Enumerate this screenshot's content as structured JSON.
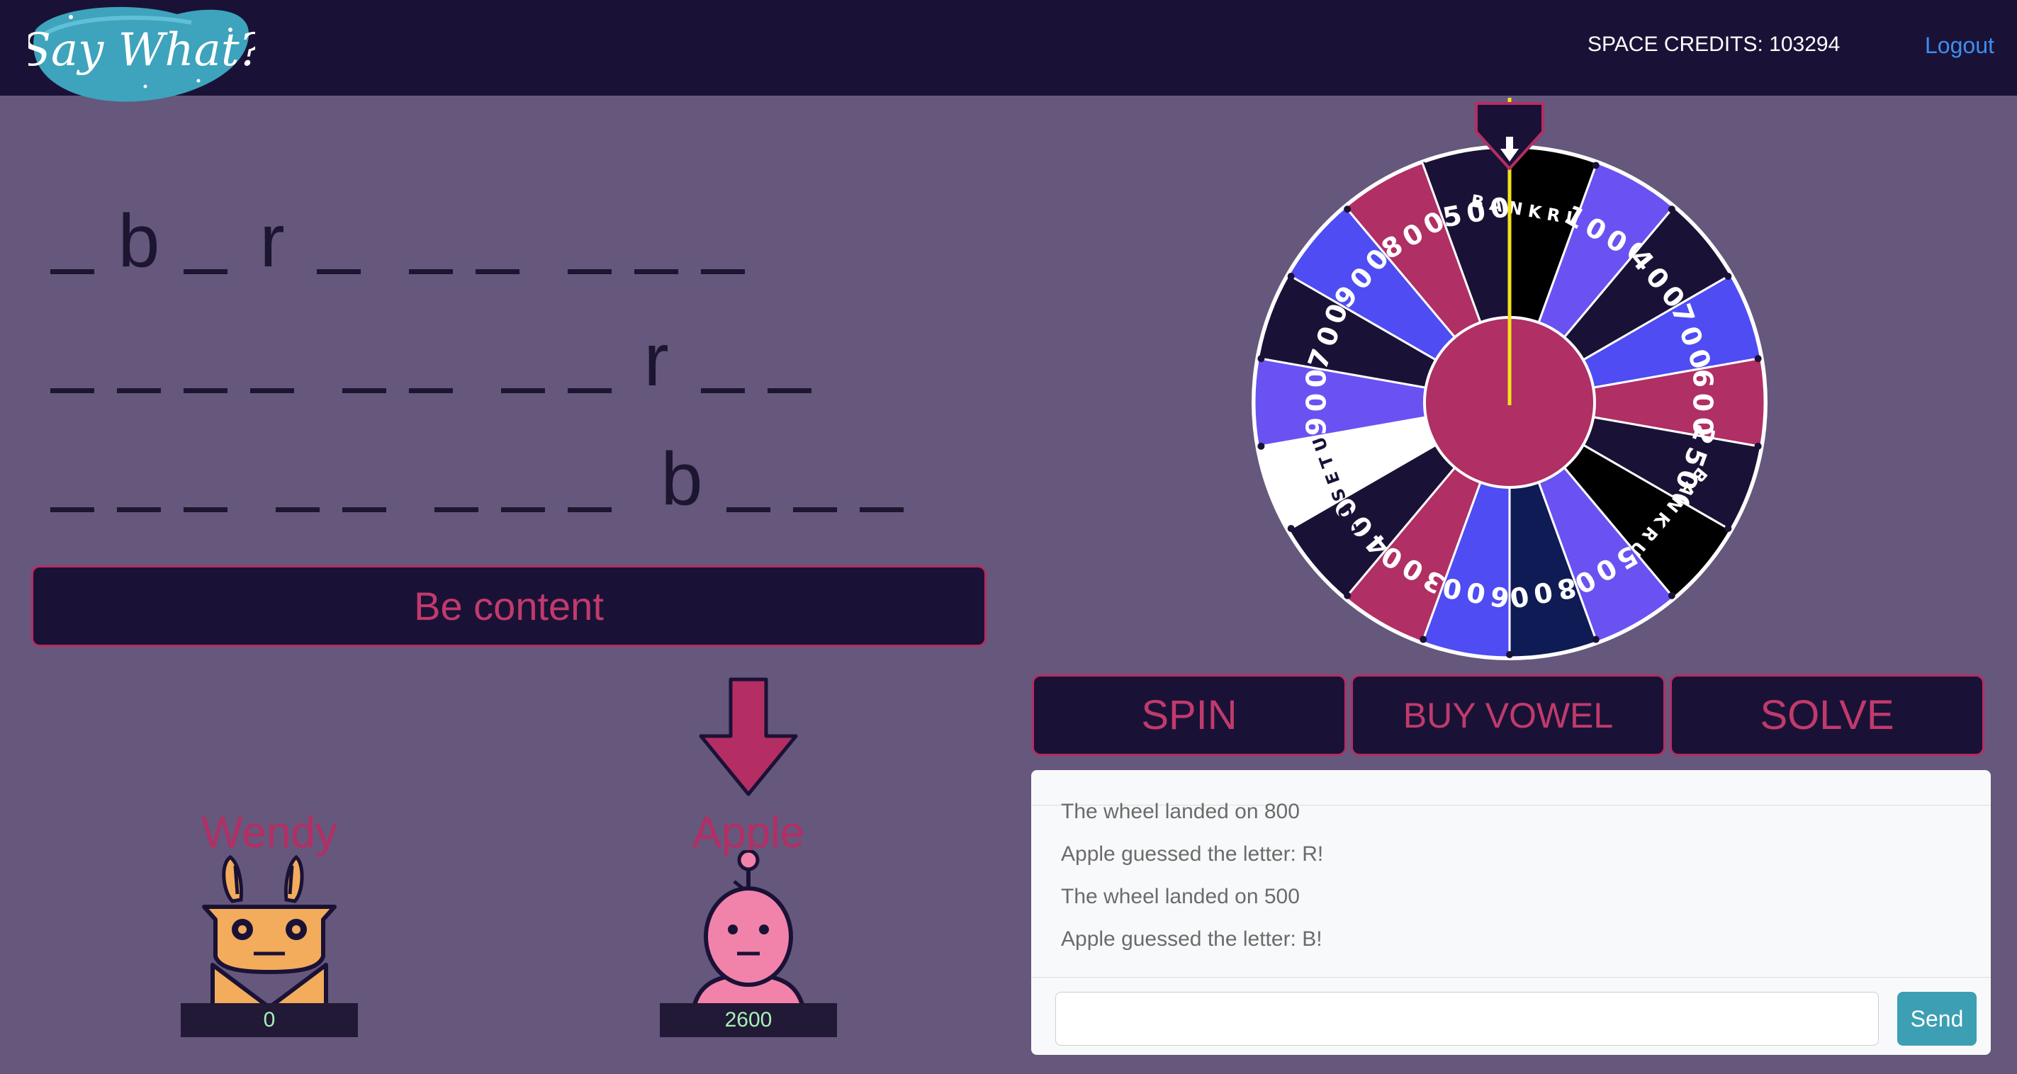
{
  "header": {
    "logo_text": "Say What?",
    "credits": "SPACE CREDITS: 103294",
    "logout": "Logout"
  },
  "puzzle": {
    "rows": [
      [
        [
          "",
          "b",
          "",
          "r",
          ""
        ],
        [
          "",
          ""
        ],
        [
          "",
          "",
          ""
        ]
      ],
      [
        [
          "",
          "",
          "",
          ""
        ],
        [
          "",
          ""
        ],
        [
          "",
          "",
          "r",
          "",
          ""
        ]
      ],
      [
        [
          "",
          "",
          ""
        ],
        [
          "",
          ""
        ],
        [
          "",
          "",
          ""
        ],
        [
          "b",
          "",
          "",
          ""
        ]
      ]
    ],
    "category": "Be content"
  },
  "players": [
    {
      "name": "Wendy",
      "score": "0",
      "avatar": "bunny-robot-icon",
      "active": false
    },
    {
      "name": "Apple",
      "score": "2600",
      "avatar": "pink-robot-icon",
      "active": true
    }
  ],
  "wheel": {
    "segments": [
      {
        "label": "500",
        "color": "#1a1236"
      },
      {
        "label": "BANKRUPT",
        "color": "#000000"
      },
      {
        "label": "1000",
        "color": "#6a52f2"
      },
      {
        "label": "400",
        "color": "#1a1236"
      },
      {
        "label": "700",
        "color": "#4e4cf2"
      },
      {
        "label": "600",
        "color": "#b02f64"
      },
      {
        "label": "2500",
        "color": "#1a1236"
      },
      {
        "label": "BANKRUPT",
        "color": "#000000"
      },
      {
        "label": "500",
        "color": "#6a52f2"
      },
      {
        "label": "800",
        "color": "#0f1b55"
      },
      {
        "label": "600",
        "color": "#4e4cf2"
      },
      {
        "label": "300",
        "color": "#b02f64"
      },
      {
        "label": "400",
        "color": "#1a1236"
      },
      {
        "label": "LOSE TURN",
        "color": "#ffffff"
      },
      {
        "label": "900",
        "color": "#6a52f2"
      },
      {
        "label": "700",
        "color": "#1a1236"
      },
      {
        "label": "900",
        "color": "#4e4cf2"
      },
      {
        "label": "800",
        "color": "#b02f64"
      }
    ],
    "hub_color": "#b02f64"
  },
  "actions": {
    "spin": "SPIN",
    "buy_vowel": "BUY VOWEL",
    "solve": "SOLVE"
  },
  "chat": {
    "messages": [
      "The wheel landed on 800",
      "Apple guessed the letter: R!",
      "The wheel landed on 500",
      "Apple guessed the letter: B!"
    ],
    "input_placeholder": "",
    "send": "Send"
  }
}
